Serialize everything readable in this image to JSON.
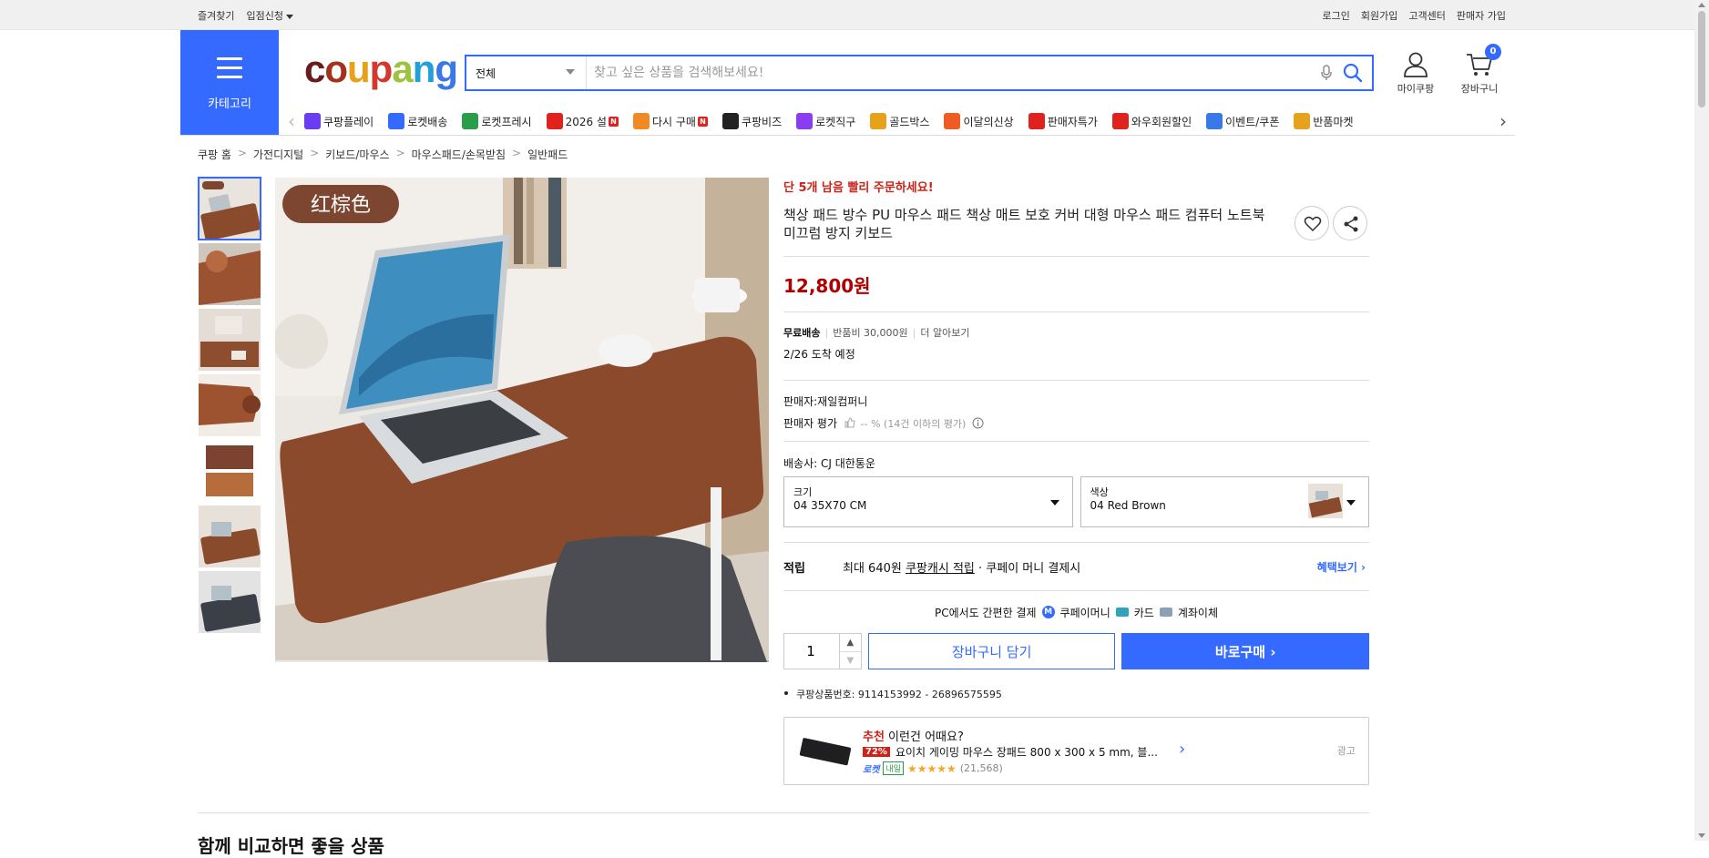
{
  "topbar": {
    "left": [
      "즐겨찾기",
      "입점신청"
    ],
    "right": [
      "로그인",
      "회원가입",
      "고객센터",
      "판매자 가입"
    ]
  },
  "header": {
    "category_label": "카테고리",
    "logo_text": "coupang",
    "search": {
      "category": "전체",
      "placeholder": "찾고 싶은 상품을 검색해보세요!"
    },
    "mycoupang_label": "마이쿠팡",
    "cart_label": "장바구니",
    "cart_count": "0"
  },
  "shortcuts": [
    {
      "label": "쿠팡플레이",
      "icon": "play-icon",
      "color": "#6b3df0",
      "new": false
    },
    {
      "label": "로켓배송",
      "icon": "rocket-icon",
      "color": "#346aff",
      "new": false
    },
    {
      "label": "로켓프레시",
      "icon": "rocket-fresh-icon",
      "color": "#2a9d4a",
      "new": false
    },
    {
      "label": "2026 설",
      "icon": "seollal-icon",
      "color": "#e0221e",
      "new": true
    },
    {
      "label": "다시 구매",
      "icon": "rebuy-icon",
      "color": "#f08a24",
      "new": true
    },
    {
      "label": "쿠팡비즈",
      "icon": "biz-icon",
      "color": "#222222",
      "new": false
    },
    {
      "label": "로켓직구",
      "icon": "global-icon",
      "color": "#8a3cf0",
      "new": false
    },
    {
      "label": "골드박스",
      "icon": "goldbox-icon",
      "color": "#e6a21c",
      "new": false
    },
    {
      "label": "이달의신상",
      "icon": "new-product-icon",
      "color": "#f05a24",
      "new": false
    },
    {
      "label": "판매자특가",
      "icon": "seller-deal-icon",
      "color": "#e0221e",
      "new": false
    },
    {
      "label": "와우회원할인",
      "icon": "wow-icon",
      "color": "#e0221e",
      "new": false
    },
    {
      "label": "이벤트/쿠폰",
      "icon": "coupon-icon",
      "color": "#3b78e7",
      "new": false
    },
    {
      "label": "반품마켓",
      "icon": "return-market-icon",
      "color": "#e6a21c",
      "new": false
    }
  ],
  "breadcrumb": [
    "쿠팡 홈",
    "가전디지털",
    "키보드/마우스",
    "마우스패드/손목받침",
    "일반패드"
  ],
  "product": {
    "urgency": "단 5개 남음 빨리 주문하세요!",
    "title": "책상 패드 방수 PU 마우스 패드 책상 매트 보호 커버 대형 마우스 패드 컴퓨터 노트북 미끄럼 방지 키보드",
    "image_tag": "红棕色",
    "price": "12,800원",
    "shipping": {
      "free": "무료배송",
      "return_fee": "반품비 30,000원",
      "more": "더 알아보기",
      "arrival": "2/26 도착 예정"
    },
    "seller": {
      "name": "판매자:재일컴퍼니",
      "rating_label": "판매자 평가",
      "rating_value": "-- % (14건 이하의 평가)"
    },
    "carrier": "배송사:  CJ 대한통운",
    "options": [
      {
        "label": "크기",
        "value": "04 35X70 CM"
      },
      {
        "label": "색상",
        "value": "04 Red Brown"
      }
    ],
    "reward": {
      "label": "적립",
      "text_pre": "최대 640원",
      "text_link": "쿠팡캐시 적립",
      "text_post": "· 쿠페이 머니 결제시",
      "more": "혜택보기 ›"
    },
    "pay": {
      "lead": "PC에서도 간편한 결제",
      "methods": [
        "쿠페이머니",
        "카드",
        "계좌이체"
      ]
    },
    "quantity": "1",
    "cart_btn": "장바구니 담기",
    "buy_btn": "바로구매 ›",
    "product_no": "쿠팡상품번호: 9114153992 - 26896575595"
  },
  "recommendation": {
    "head_red": "추천",
    "head_rest": " 이런건 어때요?",
    "discount": "72%",
    "name": "요이치 게이밍 마우스 장패드 800 x 300 x 5 mm, 블...",
    "rocket": "로켓",
    "tomorrow": "내일",
    "stars": "★★★★★",
    "reviews": "(21,568)",
    "ad": "광고"
  },
  "section_heading": "함께 비교하면 좋을 상품"
}
